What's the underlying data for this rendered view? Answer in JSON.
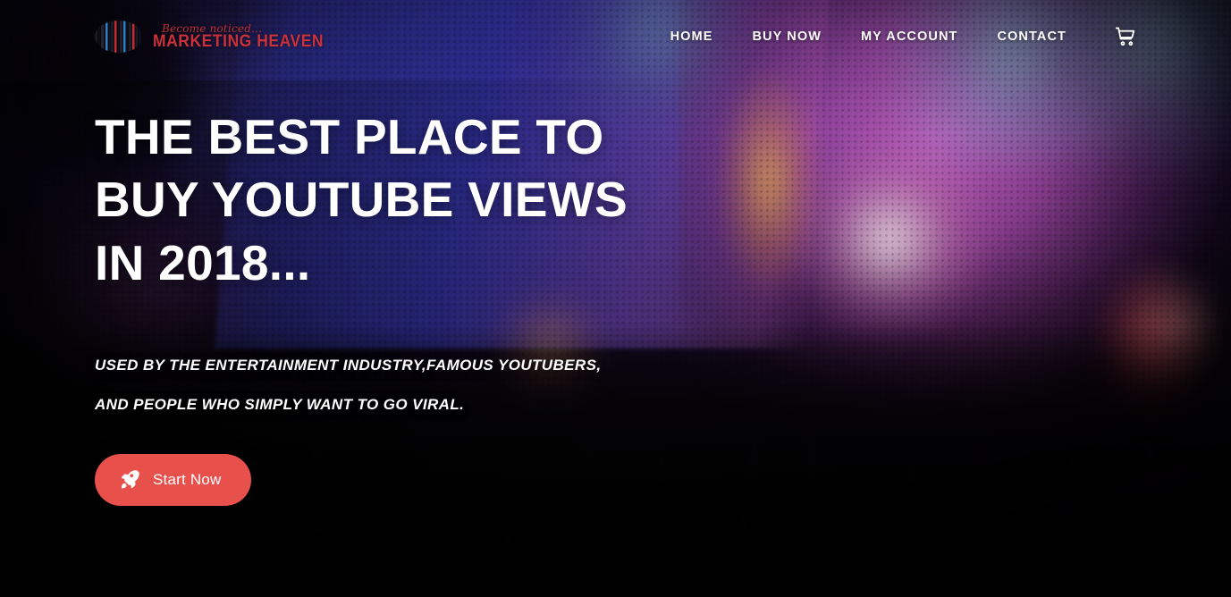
{
  "site": {
    "logo": {
      "tagline": "Become noticed...",
      "name": "MARKETING HEAVEN",
      "mark_icon": "equalizer-bars-icon"
    }
  },
  "nav": {
    "items": [
      {
        "label": "HOME",
        "name": "nav-home"
      },
      {
        "label": "BUY NOW",
        "name": "nav-buy-now"
      },
      {
        "label": "MY ACCOUNT",
        "name": "nav-my-account"
      },
      {
        "label": "CONTACT",
        "name": "nav-contact"
      }
    ],
    "cart_icon": "shopping-cart-icon"
  },
  "hero": {
    "headline_lines": [
      "THE BEST PLACE TO",
      "BUY YOUTUBE VIEWS",
      "IN 2018..."
    ],
    "subheadline_lines": [
      "USED BY THE ENTERTAINMENT INDUSTRY,FAMOUS YOUTUBERS,",
      "AND PEOPLE WHO SIMPLY WANT TO GO VIRAL."
    ],
    "cta": {
      "label": "Start Now",
      "icon": "rocket-icon"
    },
    "background": "concert-crowd-stage-photo"
  },
  "colors": {
    "cta_background": "#e8504b",
    "text_primary": "#ffffff",
    "logo_red": "#c9323c",
    "logo_blue": "#2f7fc4",
    "led_blue": "#2e2e96",
    "led_magenta": "#a85aa6"
  }
}
